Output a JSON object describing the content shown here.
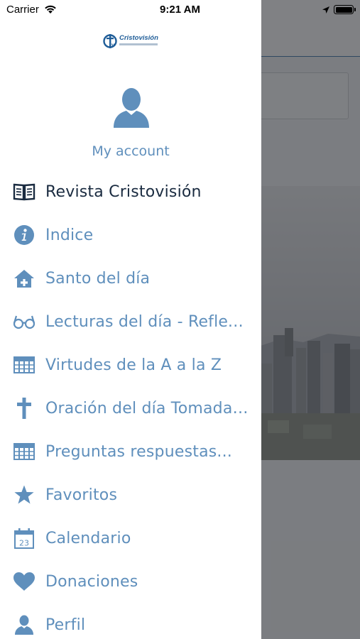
{
  "status_bar": {
    "carrier": "Carrier",
    "time": "9:21 AM"
  },
  "drawer": {
    "logo_text": "Cristovisión",
    "account_label": "My account",
    "menu": [
      {
        "label": "Revista Cristovisión",
        "icon": "book-icon",
        "active": true
      },
      {
        "label": "Indice",
        "icon": "info-icon",
        "active": false
      },
      {
        "label": "Santo del día",
        "icon": "home-plus-icon",
        "active": false
      },
      {
        "label": "Lecturas del día - Reflexiones",
        "icon": "glasses-icon",
        "active": false
      },
      {
        "label": "Virtudes de la A a la Z",
        "icon": "table-icon",
        "active": false
      },
      {
        "label": "Oración del día Tomada de...",
        "icon": "cross-icon",
        "active": false
      },
      {
        "label": "Preguntas respuestas...",
        "icon": "table-icon",
        "active": false
      },
      {
        "label": "Favoritos",
        "icon": "star-icon",
        "active": false
      },
      {
        "label": "Calendario",
        "icon": "calendar-icon",
        "active": false
      },
      {
        "label": "Donaciones",
        "icon": "heart-icon",
        "active": false
      },
      {
        "label": "Perfil",
        "icon": "person-icon",
        "active": false
      }
    ],
    "calendar_day": "23"
  },
  "colors": {
    "accent": "#5f8fbc",
    "active_text": "#1a2b40",
    "brand": "#1f5d98"
  }
}
